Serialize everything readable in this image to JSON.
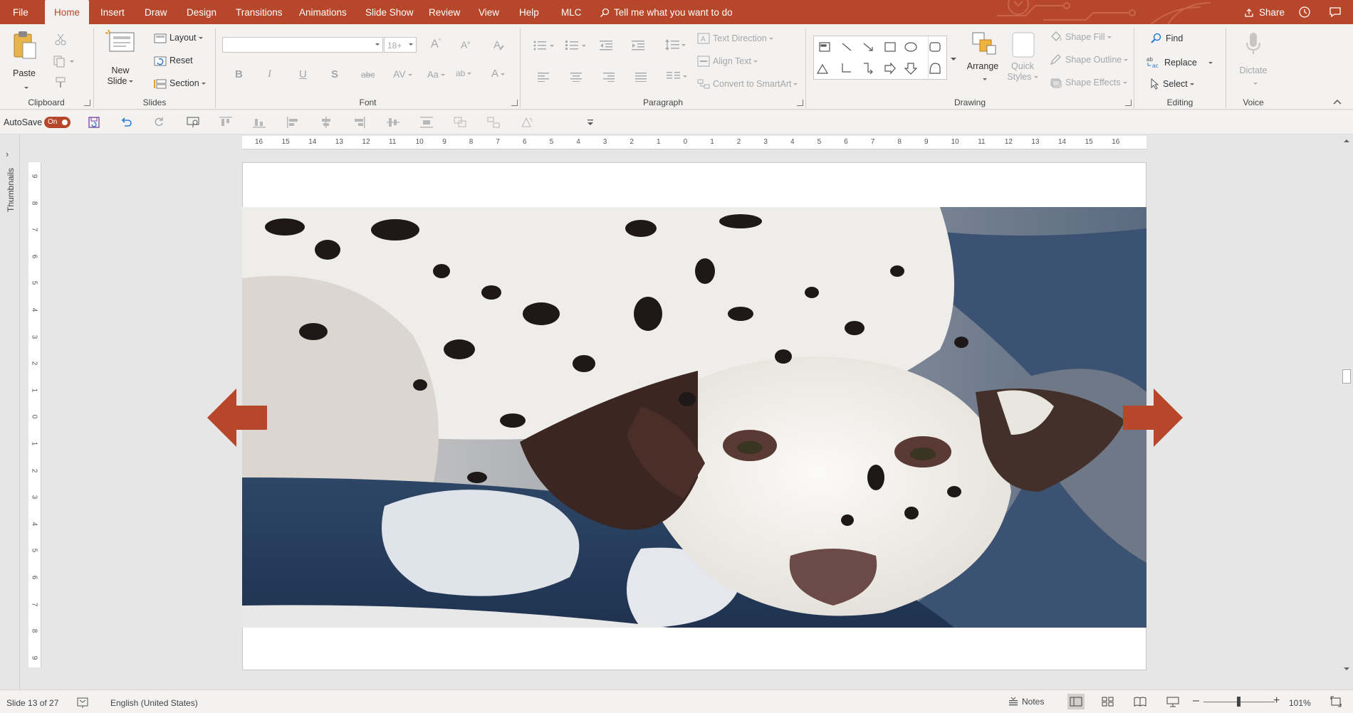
{
  "app": {
    "accent": "#b7472a"
  },
  "tabs": [
    {
      "label": "File"
    },
    {
      "label": "Home",
      "active": true
    },
    {
      "label": "Insert"
    },
    {
      "label": "Draw"
    },
    {
      "label": "Design"
    },
    {
      "label": "Transitions"
    },
    {
      "label": "Animations"
    },
    {
      "label": "Slide Show"
    },
    {
      "label": "Review"
    },
    {
      "label": "View"
    },
    {
      "label": "Help"
    },
    {
      "label": "MLC"
    }
  ],
  "search": {
    "placeholder": "Tell me what you want to do"
  },
  "share_label": "Share",
  "ribbon": {
    "clipboard": {
      "label": "Clipboard",
      "paste": "Paste"
    },
    "slides": {
      "label": "Slides",
      "new_slide_line1": "New",
      "new_slide_line2": "Slide",
      "layout": "Layout",
      "reset": "Reset",
      "section": "Section"
    },
    "font": {
      "label": "Font",
      "font_name": "",
      "font_size": "18+"
    },
    "paragraph": {
      "label": "Paragraph",
      "text_direction": "Text Direction",
      "align_text": "Align Text",
      "convert_smartart": "Convert to SmartArt"
    },
    "drawing": {
      "label": "Drawing",
      "arrange": "Arrange",
      "quick_styles_line1": "Quick",
      "quick_styles_line2": "Styles",
      "shape_fill": "Shape Fill",
      "shape_outline": "Shape Outline",
      "shape_effects": "Shape Effects"
    },
    "editing": {
      "label": "Editing",
      "find": "Find",
      "replace": "Replace",
      "select": "Select"
    },
    "voice": {
      "label": "Voice",
      "dictate": "Dictate"
    }
  },
  "qat": {
    "autosave_label": "AutoSave",
    "autosave_state": "On"
  },
  "thumbnails_label": "Thumbnails",
  "ruler": {
    "horizontal": [
      "16",
      "15",
      "14",
      "13",
      "12",
      "11",
      "10",
      "9",
      "8",
      "7",
      "6",
      "5",
      "4",
      "3",
      "2",
      "1",
      "0",
      "1",
      "2",
      "3",
      "4",
      "5",
      "6",
      "7",
      "8",
      "9",
      "10",
      "11",
      "12",
      "13",
      "14",
      "15",
      "16"
    ],
    "vertical": [
      "9",
      "8",
      "7",
      "6",
      "5",
      "4",
      "3",
      "2",
      "1",
      "0",
      "1",
      "2",
      "3",
      "4",
      "5",
      "6",
      "7",
      "8",
      "9"
    ]
  },
  "slide": {
    "image": "dalmatian-puppy-photo"
  },
  "status": {
    "slide_info": "Slide 13 of 27",
    "language": "English (United States)",
    "notes": "Notes",
    "zoom": "101%",
    "zoom_level": 0.5
  }
}
